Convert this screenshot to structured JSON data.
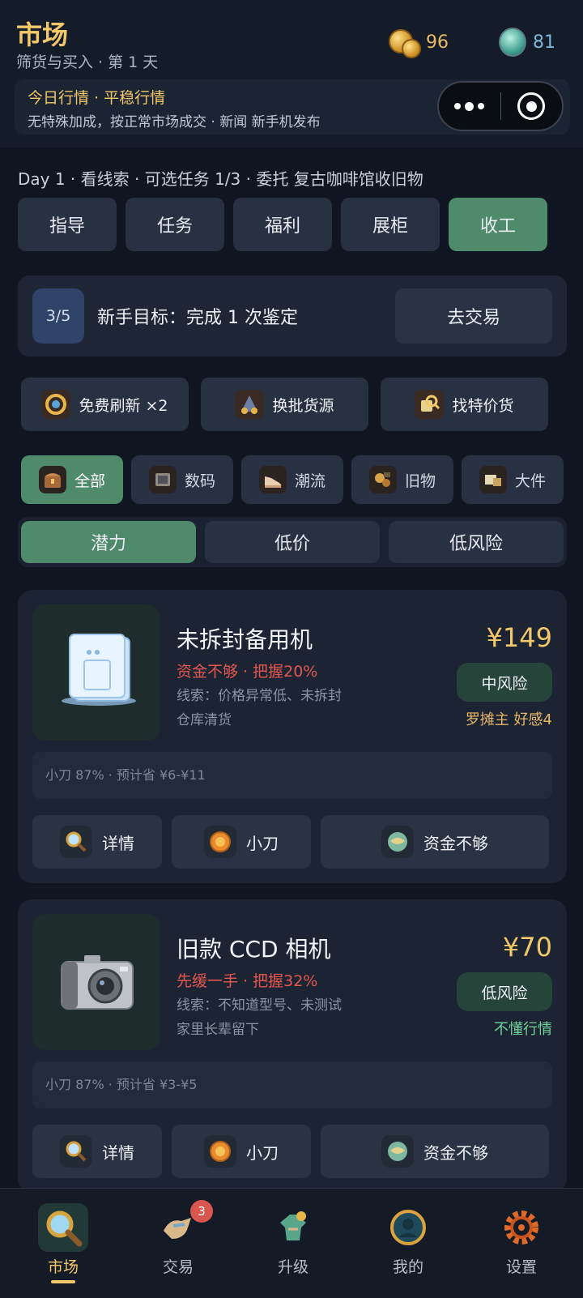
{
  "header": {
    "title": "市场",
    "subtitle": "筛货与买入 · 第 1 天",
    "gold": "96",
    "gems": "81",
    "news_title": "今日行情 · 平稳行情",
    "news_desc": "无特殊加成，按正常市场成交 · 新闻 新手机发布"
  },
  "day_line": "Day 1 · 看线索 · 可选任务 1/3 · 委托 复古咖啡馆收旧物",
  "main_tabs": [
    {
      "label": "指导"
    },
    {
      "label": "任务"
    },
    {
      "label": "福利"
    },
    {
      "label": "展柜"
    },
    {
      "label": "收工"
    }
  ],
  "goal": {
    "progress": "3/5",
    "text": "新手目标：完成 1 次鉴定",
    "button": "去交易"
  },
  "tools": [
    {
      "label": "免费刷新 ×2",
      "icon": "refresh-icon"
    },
    {
      "label": "换批货源",
      "icon": "swap-icon"
    },
    {
      "label": "找特价货",
      "icon": "search-deal-icon"
    }
  ],
  "categories": [
    {
      "label": "全部",
      "icon": "all-icon"
    },
    {
      "label": "数码",
      "icon": "digital-icon"
    },
    {
      "label": "潮流",
      "icon": "sneaker-icon"
    },
    {
      "label": "旧物",
      "icon": "antique-icon"
    },
    {
      "label": "大件",
      "icon": "large-item-icon"
    }
  ],
  "filters": [
    {
      "label": "潜力"
    },
    {
      "label": "低价"
    },
    {
      "label": "低风险"
    }
  ],
  "items": [
    {
      "name": "未拆封备用机",
      "warning": "资金不够 · 把握20%",
      "clue": "线索：价格异常低、未拆封",
      "source": "仓库清货",
      "price": "¥149",
      "risk": "中风险",
      "seller": "罗摊主 好感4",
      "note": "小刀 87% · 预计省 ¥6-¥11",
      "actions": [
        "详情",
        "小刀",
        "资金不够"
      ]
    },
    {
      "name": "旧款 CCD 相机",
      "warning": "先缓一手 · 把握32%",
      "clue": "线索：不知道型号、未测试",
      "source": "家里长辈留下",
      "price": "¥70",
      "risk": "低风险",
      "seller": "不懂行情",
      "note": "小刀 87% · 预计省 ¥3-¥5",
      "actions": [
        "详情",
        "小刀",
        "资金不够"
      ]
    }
  ],
  "bottom_nav": [
    {
      "label": "市场",
      "icon": "magnifier-icon"
    },
    {
      "label": "交易",
      "icon": "trade-icon",
      "badge": "3"
    },
    {
      "label": "升级",
      "icon": "upgrade-icon"
    },
    {
      "label": "我的",
      "icon": "profile-icon"
    },
    {
      "label": "设置",
      "icon": "settings-gear-icon"
    }
  ],
  "colors": {
    "accent_green": "#4f8a6a",
    "gold": "#f2c86a",
    "warning_red": "#e3574e",
    "positive_green": "#6fd39a",
    "background": "#0f1622"
  }
}
